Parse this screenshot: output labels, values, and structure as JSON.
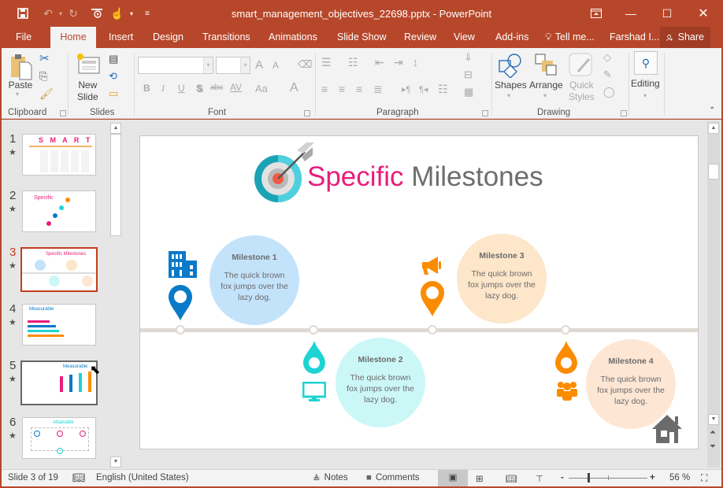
{
  "titlebar": {
    "title": "smart_management_objectives_22698.pptx - PowerPoint",
    "qat": [
      "save-icon",
      "undo-icon",
      "redo-icon",
      "start-from-beginning-icon",
      "touch-mode-icon",
      "customize-qat-icon"
    ]
  },
  "tabs": [
    "File",
    "Home",
    "Insert",
    "Design",
    "Transitions",
    "Animations",
    "Slide Show",
    "Review",
    "View",
    "Add-ins"
  ],
  "active_tab": "Home",
  "tell_me": "Tell me...",
  "user": "Farshad I...",
  "share": "Share",
  "ribbon": {
    "clipboard": {
      "label": "Clipboard",
      "paste": "Paste"
    },
    "slides": {
      "label": "Slides",
      "new_slide_1": "New",
      "new_slide_2": "Slide"
    },
    "font": {
      "label": "Font",
      "bold": "B",
      "italic": "I",
      "underline": "U",
      "shadow": "S",
      "strike": "abc",
      "spacing": "AV",
      "case": "Aa",
      "color": "A",
      "grow": "A",
      "shrink": "A"
    },
    "paragraph": {
      "label": "Paragraph"
    },
    "drawing": {
      "label": "Drawing",
      "shapes": "Shapes",
      "arrange": "Arrange",
      "quick_1": "Quick",
      "quick_2": "Styles"
    },
    "editing": {
      "label": "Editing"
    }
  },
  "thumbnails": [
    {
      "num": "1",
      "title": "S M A R T"
    },
    {
      "num": "2",
      "title": "Specific"
    },
    {
      "num": "3",
      "title": "Specific Milestones",
      "current": true
    },
    {
      "num": "4",
      "title": "Measurable"
    },
    {
      "num": "5",
      "title": "Measurable"
    },
    {
      "num": "6",
      "title": "Attainable"
    }
  ],
  "slide": {
    "title_accent": "Specific",
    "title_rest": "Milestones",
    "colors": {
      "accent": "#e91e7a",
      "blue": "#0a79c7",
      "cyan": "#1fd3d3",
      "orange": "#fb8c00",
      "line": "#dedad3"
    },
    "milestones": [
      {
        "title": "Milestone 1",
        "text": "The quick brown fox jumps over the lazy dog.",
        "icon": "building-icon"
      },
      {
        "title": "Milestone 2",
        "text": "The quick brown fox jumps over the lazy dog.",
        "icon": "monitor-icon"
      },
      {
        "title": "Milestone 3",
        "text": "The quick brown fox jumps over the lazy dog.",
        "icon": "megaphone-icon"
      },
      {
        "title": "Milestone 4",
        "text": "The quick brown fox jumps over the lazy dog.",
        "icon": "people-icon"
      }
    ]
  },
  "status": {
    "slide_info": "Slide 3 of 19",
    "language": "English (United States)",
    "notes": "Notes",
    "comments": "Comments",
    "zoom": "56 %",
    "zoom_minus": "-",
    "zoom_plus": "+"
  }
}
